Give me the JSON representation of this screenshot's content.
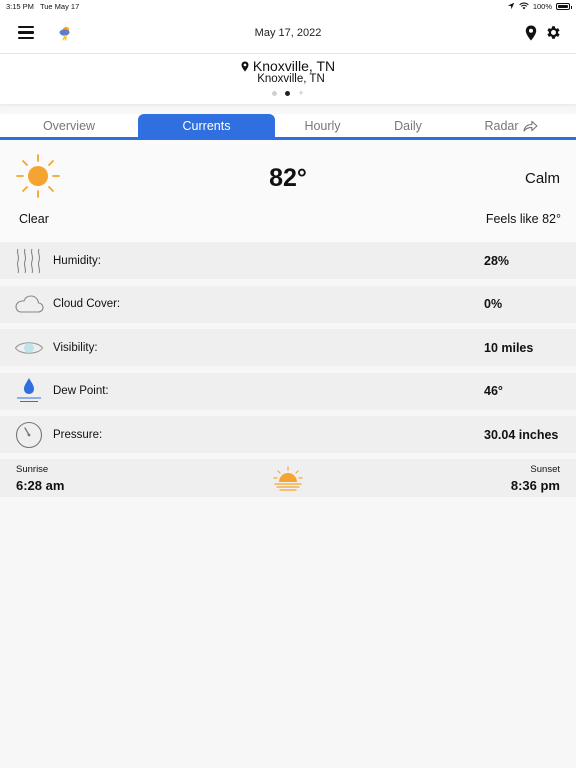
{
  "status": {
    "time": "3:15 PM",
    "date": "Tue May 17",
    "battery": "100%"
  },
  "header": {
    "date": "May 17, 2022"
  },
  "location": {
    "name": "Knoxville, TN",
    "subtitle": "Knoxville, TN"
  },
  "tabs": [
    {
      "label": "Overview"
    },
    {
      "label": "Currents"
    },
    {
      "label": "Hourly"
    },
    {
      "label": "Daily"
    },
    {
      "label": "Radar"
    }
  ],
  "current": {
    "temperature": "82°",
    "wind": "Calm",
    "condition": "Clear",
    "feels_like": "Feels like 82°"
  },
  "details": [
    {
      "label": "Humidity:",
      "value": "28%"
    },
    {
      "label": "Cloud Cover:",
      "value": "0%"
    },
    {
      "label": "Visibility:",
      "value": "10 miles"
    },
    {
      "label": "Dew Point:",
      "value": "46°"
    },
    {
      "label": "Pressure:",
      "value": "30.04 inches"
    }
  ],
  "sun": {
    "sunrise_label": "Sunrise",
    "sunrise_time": "6:28 am",
    "sunset_label": "Sunset",
    "sunset_time": "8:36 pm"
  },
  "colors": {
    "accent": "#2f6fe0",
    "sun": "#f6a431"
  }
}
